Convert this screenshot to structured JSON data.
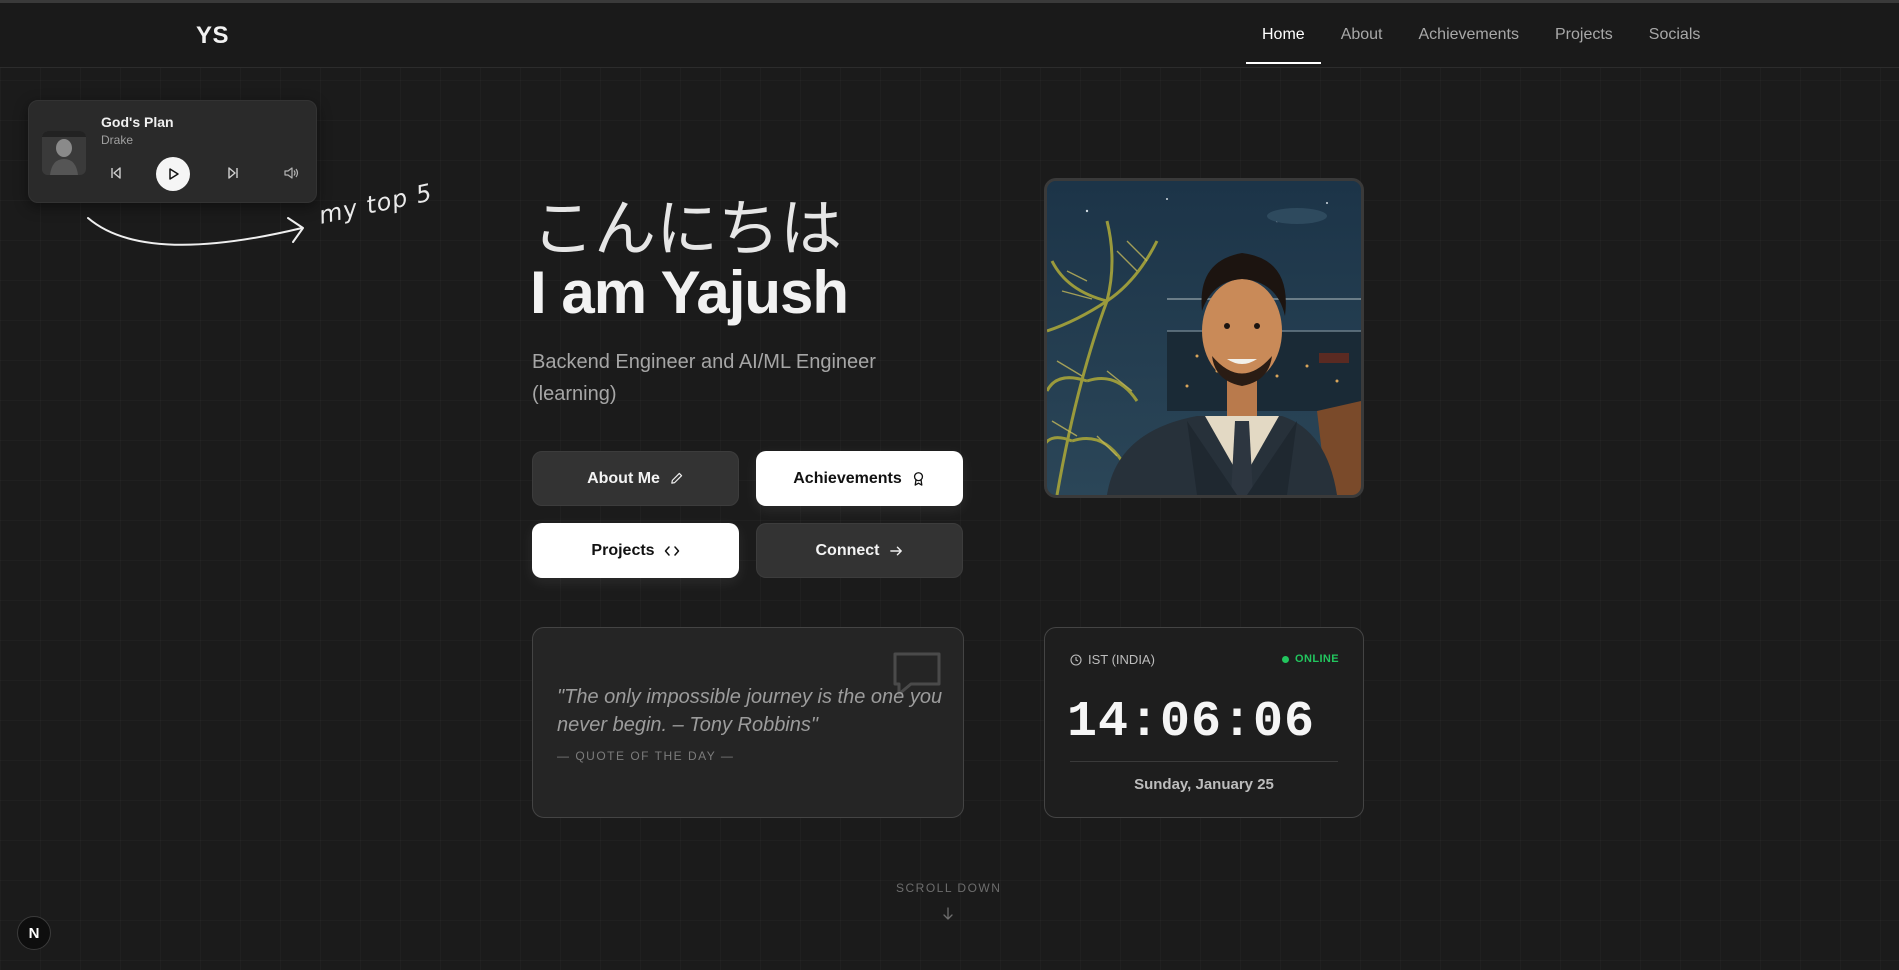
{
  "header": {
    "logo": "YS",
    "nav": [
      "Home",
      "About",
      "Achievements",
      "Projects",
      "Socials"
    ],
    "active_nav": "Home"
  },
  "player": {
    "title": "God's Plan",
    "artist": "Drake",
    "note": "my top 5",
    "icons": [
      "prev-icon",
      "play-icon",
      "next-icon",
      "volume-icon"
    ]
  },
  "hero": {
    "greeting": "こんにちは",
    "name": "I am Yajush",
    "role": "Backend Engineer and AI/ML Engineer (learning)"
  },
  "buttons": {
    "about": "About Me",
    "achievements": "Achievements",
    "projects": "Projects",
    "connect": "Connect"
  },
  "quote": {
    "text": "\"The only impossible journey is the one you never begin. – Tony Robbins\"",
    "label": "— QUOTE OF THE DAY —"
  },
  "clock": {
    "timezone": "IST (INDIA)",
    "status": "ONLINE",
    "time": "14:06:06",
    "date": "Sunday, January 25"
  },
  "scroll": {
    "label": "SCROLL DOWN"
  },
  "badge": {
    "label": "N"
  },
  "colors": {
    "background": "#1b1b1b",
    "online": "#22c55e",
    "button_light": "#ffffff",
    "button_dark": "#333333"
  }
}
